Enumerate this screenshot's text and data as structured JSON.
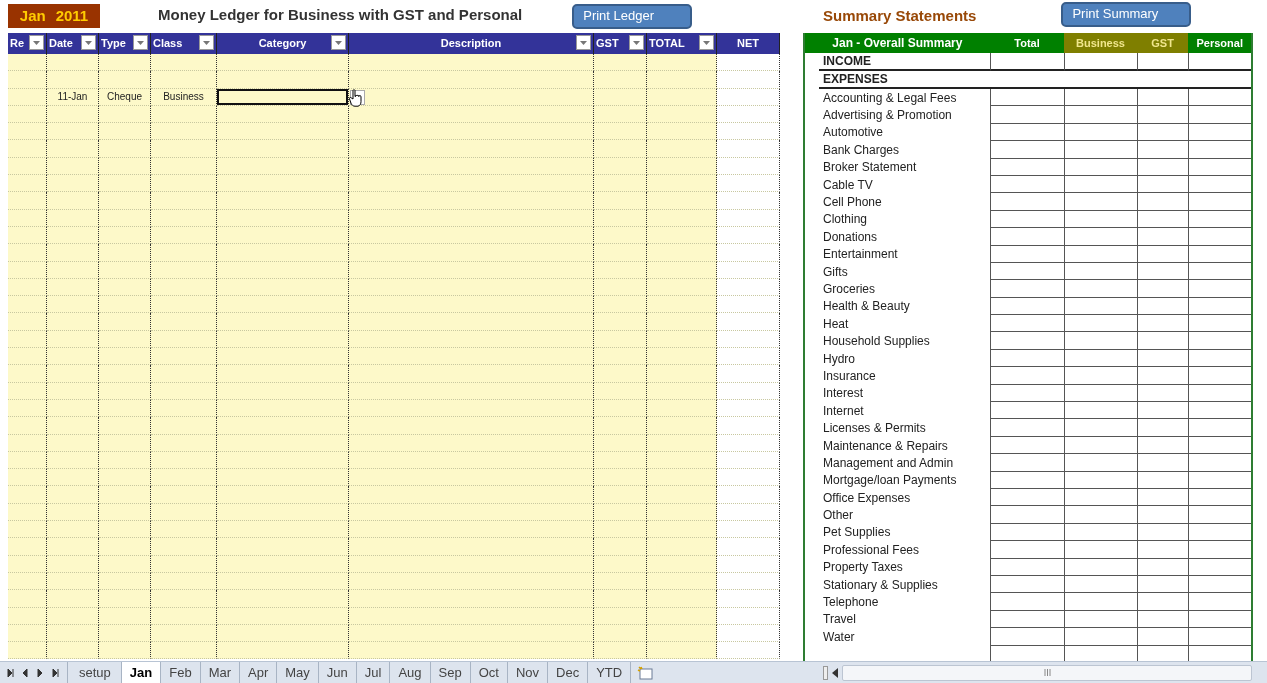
{
  "ledger": {
    "month": "Jan",
    "year": "2011",
    "title": "Money Ledger for Business with GST and Personal",
    "print_button": "Print Ledger",
    "columns": [
      {
        "label": "Re",
        "filter": true
      },
      {
        "label": "Date",
        "filter": true
      },
      {
        "label": "Type",
        "filter": true
      },
      {
        "label": "Class",
        "filter": true
      },
      {
        "label": "Category",
        "filter": true
      },
      {
        "label": "Description",
        "filter": true
      },
      {
        "label": "GST",
        "filter": true
      },
      {
        "label": "TOTAL",
        "filter": true
      },
      {
        "label": "NET",
        "filter": false
      }
    ],
    "entries": [
      {
        "date": "11-Jan",
        "type": "Cheque",
        "class": "Business",
        "category": {
          "selected": true
        }
      }
    ]
  },
  "summary": {
    "title": "Summary Statements",
    "print_button": "Print Summary",
    "columns": [
      {
        "label": "Jan - Overall Summary",
        "color": "#008000"
      },
      {
        "label": "Total",
        "color": "#008000"
      },
      {
        "label": "Business",
        "color": "#7f7f00"
      },
      {
        "label": "GST",
        "color": "#7f7f00"
      },
      {
        "label": "Personal",
        "color": "#008000"
      }
    ],
    "sections": [
      "INCOME",
      "EXPENSES"
    ],
    "items": [
      "Accounting & Legal Fees",
      "Advertising & Promotion",
      "Automotive",
      "Bank Charges",
      "Broker Statement",
      "Cable TV",
      "Cell Phone",
      "Clothing",
      "Donations",
      "Entertainment",
      "Gifts",
      "Groceries",
      "Health & Beauty",
      "Heat",
      "Household Supplies",
      "Hydro",
      "Insurance",
      "Interest",
      "Internet",
      "Licenses & Permits",
      "Maintenance & Repairs",
      "Management and Admin",
      "Mortgage/loan Payments",
      "Office Expenses",
      "Other",
      "Pet Supplies",
      "Professional Fees",
      "Property Taxes",
      "Stationary & Supplies",
      "Telephone",
      "Travel",
      "Water"
    ]
  },
  "sheet_tabs": [
    {
      "label": "setup",
      "selected": false
    },
    {
      "label": "Jan",
      "selected": true
    },
    {
      "label": "Feb",
      "selected": false
    },
    {
      "label": "Mar",
      "selected": false
    },
    {
      "label": "Apr",
      "selected": false
    },
    {
      "label": "May",
      "selected": false
    },
    {
      "label": "Jun",
      "selected": false
    },
    {
      "label": "Jul",
      "selected": false
    },
    {
      "label": "Aug",
      "selected": false
    },
    {
      "label": "Sep",
      "selected": false
    },
    {
      "label": "Oct",
      "selected": false
    },
    {
      "label": "Nov",
      "selected": false
    },
    {
      "label": "Dec",
      "selected": false
    },
    {
      "label": "YTD",
      "selected": false
    }
  ]
}
